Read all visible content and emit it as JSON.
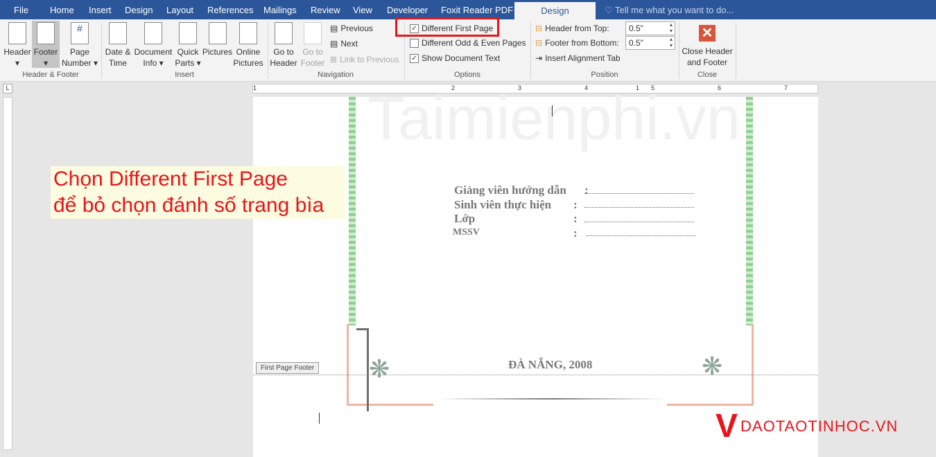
{
  "tabs": [
    "File",
    "Home",
    "Insert",
    "Design",
    "Layout",
    "References",
    "Mailings",
    "Review",
    "View",
    "Developer",
    "Foxit Reader PDF",
    "Design"
  ],
  "tell_me": "Tell me what you want to do...",
  "groups": {
    "hf": "Header & Footer",
    "insert": "Insert",
    "nav": "Navigation",
    "options": "Options",
    "position": "Position",
    "close": "Close"
  },
  "buttons": {
    "header": "Header",
    "footer": "Footer",
    "page_number": "Page Number",
    "date_time": "Date & Time",
    "doc_info": "Document Info",
    "quick_parts": "Quick Parts",
    "pictures": "Pictures",
    "online_pictures": "Online Pictures",
    "goto_header": "Go to Header",
    "goto_footer": "Go to Footer",
    "previous": "Previous",
    "next": "Next",
    "link_prev": "Link to Previous",
    "close": "Close Header and Footer"
  },
  "options": {
    "diff_first": "Different First Page",
    "diff_odd": "Different Odd & Even Pages",
    "show_text": "Show Document Text"
  },
  "position": {
    "header_top_label": "Header from Top:",
    "header_top": "0.5\"",
    "footer_bottom_label": "Footer from Bottom:",
    "footer_bottom": "0.5\"",
    "align_tab": "Insert Alignment Tab"
  },
  "ruler": [
    "1",
    "1",
    "2",
    "3",
    "4",
    "5",
    "6",
    "7"
  ],
  "doc": {
    "watermark": "Taimienphi.vn",
    "rows": [
      {
        "label": "Giảng viên hướng dẫn",
        "colon": ":"
      },
      {
        "label": "Sinh viên thực hiện",
        "colon": ":"
      },
      {
        "label": "Lớp",
        "colon": ":"
      },
      {
        "label": "MSSV",
        "colon": ":"
      }
    ],
    "city": "ĐÀ NẴNG, 2008",
    "footer_label": "First Page Footer"
  },
  "note": {
    "line1": "Chọn Different First Page",
    "line2": "để bỏ chọn đánh số trang bìa"
  },
  "logo": "DAOTAOTINHOC.VN"
}
